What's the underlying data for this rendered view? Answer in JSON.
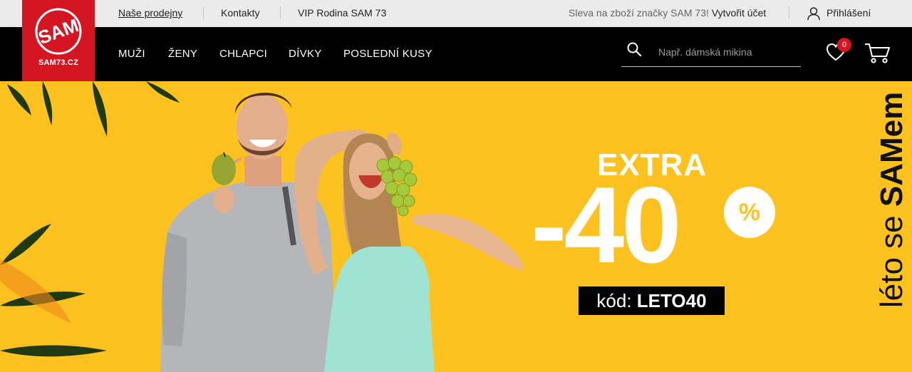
{
  "logo": {
    "text": "SAM73.CZ",
    "emblem": "SAM"
  },
  "topbar": {
    "links": [
      "Naše prodejny",
      "Kontakty",
      "VIP Rodina SAM 73"
    ],
    "promo_text": "Sleva na zboží značky SAM 73!",
    "promo_link": "Vytvořit účet",
    "login": "Přihlášení"
  },
  "nav": {
    "items": [
      "MUŽI",
      "ŽENY",
      "CHLAPCI",
      "DÍVKY",
      "POSLEDNÍ KUSY"
    ]
  },
  "search": {
    "placeholder": "Např. dámská mikina",
    "value": ""
  },
  "wishlist": {
    "count": "0"
  },
  "hero": {
    "extra": "EXTRA",
    "discount": "-40",
    "percent_sign": "%",
    "code_label": "kód:",
    "code_value": "LETO40",
    "tagline_prefix": "léto se",
    "tagline_brand": "SAMem"
  },
  "colors": {
    "accent": "#d51622",
    "hero_bg": "#fdc120",
    "nav_bg": "#000000",
    "topbar_bg": "#ebebeb"
  }
}
